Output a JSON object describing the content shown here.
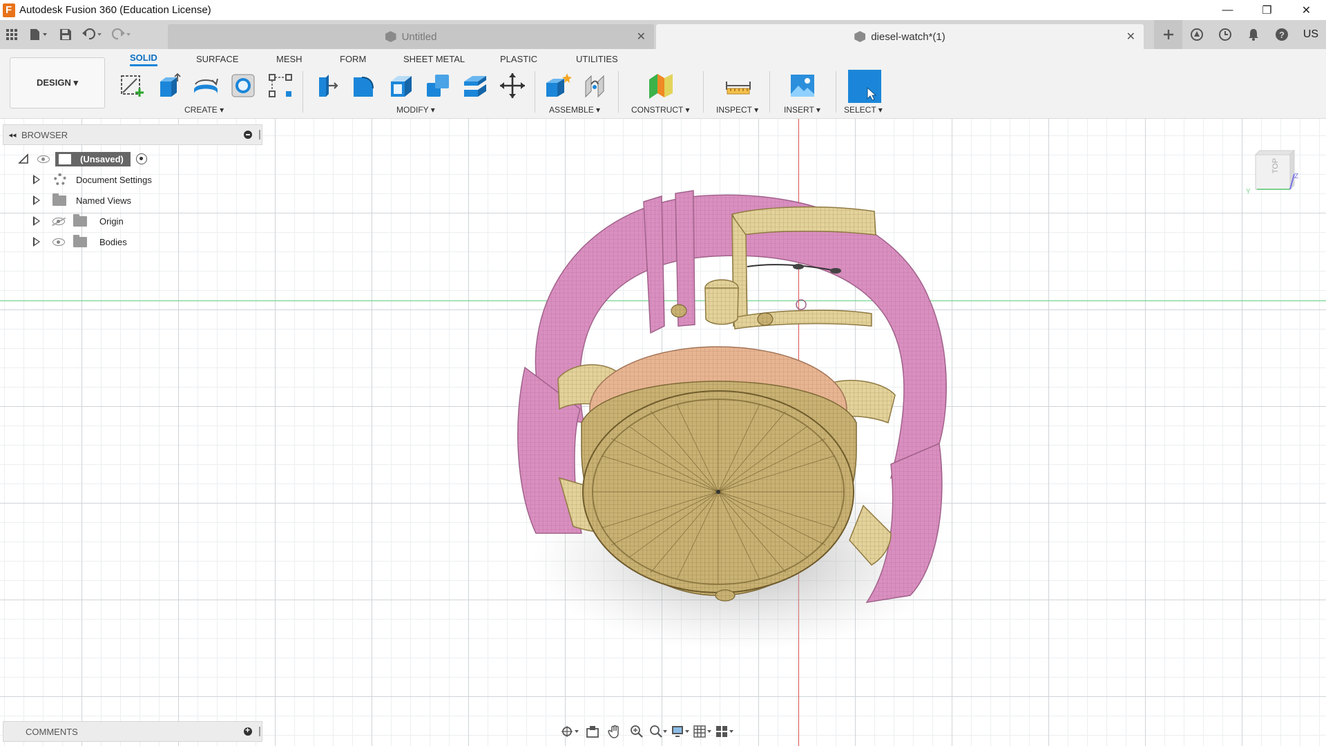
{
  "window": {
    "title": "Autodesk Fusion 360 (Education License)",
    "controls": [
      "—",
      "❐",
      "✕"
    ]
  },
  "tabs": {
    "inactive_title": "Untitled",
    "active_title": "diesel-watch*(1)",
    "close_glyph": "✕",
    "user_initials": "US"
  },
  "toolbar": {
    "design_label": "DESIGN ▾",
    "workspace_tabs": [
      "SOLID",
      "SURFACE",
      "MESH",
      "FORM",
      "SHEET METAL",
      "PLASTIC",
      "UTILITIES"
    ],
    "groups": {
      "create": "CREATE ▾",
      "modify": "MODIFY ▾",
      "assemble": "ASSEMBLE ▾",
      "construct": "CONSTRUCT ▾",
      "inspect": "INSPECT ▾",
      "insert": "INSERT ▾",
      "select": "SELECT ▾"
    }
  },
  "browser": {
    "title": "BROWSER",
    "root": "(Unsaved)",
    "items": [
      "Document Settings",
      "Named Views",
      "Origin",
      "Bodies"
    ]
  },
  "comments": {
    "title": "COMMENTS"
  },
  "viewcube": {
    "face": "TOP",
    "axis_y": "Y",
    "axis_z": "Z"
  },
  "colors": {
    "strap": "#d98fbf",
    "case": "#c9b173",
    "dial_ring": "#e8b592",
    "accent": "#1b86d9"
  }
}
